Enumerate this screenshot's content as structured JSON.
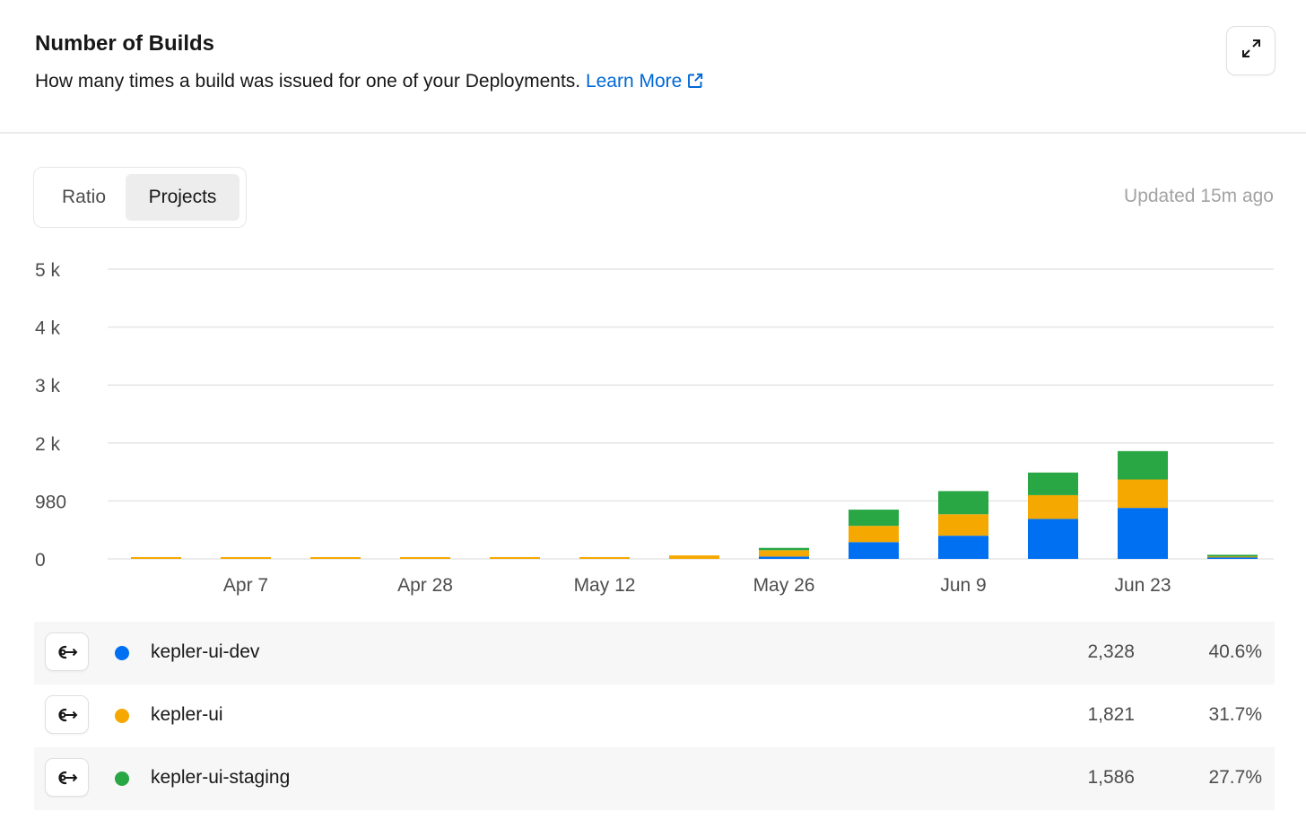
{
  "header": {
    "title": "Number of Builds",
    "description": "How many times a build was issued for one of your Deployments.",
    "learn_more": "Learn More"
  },
  "toggle": {
    "ratio_label": "Ratio",
    "projects_label": "Projects",
    "selected": "Projects"
  },
  "updated": "Updated 15m ago",
  "icons": {
    "expand": "expand-icon",
    "external": "external-link-icon",
    "project": "project-icon"
  },
  "colors": {
    "kepler-ui-dev": "#0070f3",
    "kepler-ui": "#f5a800",
    "kepler-ui-staging": "#29a745",
    "grid": "#e6e6e6"
  },
  "chart_data": {
    "type": "bar",
    "stacked": true,
    "y_tick_labels": [
      "0",
      "980",
      "2 k",
      "3 k",
      "4 k",
      "5 k"
    ],
    "ylim": [
      0,
      5000
    ],
    "x_tick_labels": [
      "Apr 7",
      "Apr 28",
      "May 12",
      "May 26",
      "Jun 9",
      "Jun 23"
    ],
    "grid": true,
    "series": [
      {
        "name": "kepler-ui-dev",
        "color": "#0070f3",
        "values": [
          0,
          0,
          0,
          0,
          0,
          0,
          0,
          40,
          290,
          400,
          690,
          880,
          25
        ]
      },
      {
        "name": "kepler-ui",
        "color": "#f5a800",
        "values": [
          5,
          10,
          5,
          20,
          30,
          30,
          60,
          110,
          280,
          370,
          410,
          490,
          15
        ]
      },
      {
        "name": "kepler-ui-staging",
        "color": "#29a745",
        "values": [
          0,
          0,
          0,
          0,
          0,
          0,
          0,
          40,
          280,
          400,
          390,
          490,
          10
        ]
      }
    ]
  },
  "legend": [
    {
      "name": "kepler-ui-dev",
      "count": "2,328",
      "percent": "40.6%",
      "color": "#0070f3"
    },
    {
      "name": "kepler-ui",
      "count": "1,821",
      "percent": "31.7%",
      "color": "#f5a800"
    },
    {
      "name": "kepler-ui-staging",
      "count": "1,586",
      "percent": "27.7%",
      "color": "#29a745"
    }
  ]
}
